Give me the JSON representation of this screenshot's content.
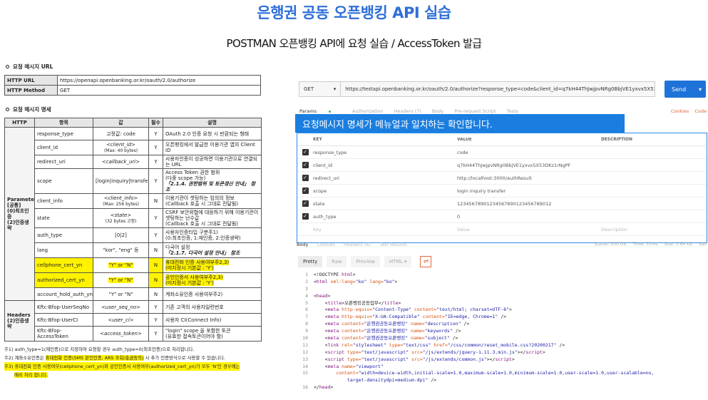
{
  "slide": {
    "title": "은행권 공동 오픈뱅킹 API 실습",
    "subtitle": "POSTMAN 오픈뱅킹 API에 요청 실습 / AccessToken 발급"
  },
  "doc": {
    "url_section": {
      "heading": "요청 메시지 URL",
      "http_url_key": "HTTP URL",
      "http_url_value": "https://openapi.openbanking.or.kr/oauth/2.0/authorize",
      "http_method_key": "HTTP Method",
      "http_method_value": "GET"
    },
    "spec_section": {
      "heading": "요청 메시지 명세",
      "columns": [
        "HTTP",
        "항목",
        "값",
        "필수",
        "설명"
      ],
      "group_params": "Parameter\n[공통]\n(0)최초인증\n(2)인증생략",
      "group_headers": "Headers\n(2)인증생략",
      "rows": [
        {
          "name": "response_type",
          "value": "고정값: code",
          "req": "Y",
          "desc": "OAuth 2.0 인증 요청 시 반환되는 형태"
        },
        {
          "name": "client_id",
          "value": "<client_id>",
          "value2": "(Max: 40 bytes)",
          "req": "Y",
          "desc": "오픈뱅킹에서 발급한 이용기관 앱의 Client ID"
        },
        {
          "name": "redirect_uri",
          "value": "<callback_uri>",
          "req": "Y",
          "desc": "사용자인증이 성공하면 이용기관으로 연결되는 URL"
        },
        {
          "name": "scope",
          "value": "[login|inquiry|transfer]",
          "req": "Y",
          "desc": "Access Token 권한 범위",
          "desc2": "(다중 scope 가능)",
          "desc3": "「2.1.4. 권한범위 및 토큰갱신 안내」 참조"
        },
        {
          "name": "client_info",
          "value": "<client_info>",
          "value2": "(Max: 256 bytes)",
          "req": "N",
          "desc": "이용기관이 셋팅하는 임의의 정보",
          "desc2": "(Callback 호출 시 그대로 전달됨)"
        },
        {
          "name": "state",
          "value": "<state>",
          "value2": "(32 bytes 고정)",
          "req": "Y",
          "desc": "CSRF 보안위협에 대응하기 위해 이용기관이 셋팅하는 난수값",
          "desc2": "(Callback 호출 시 그대로 전달됨)"
        },
        {
          "name": "auth_type",
          "value": "[0|2]",
          "req": "Y",
          "desc": "사용자인증타입 구분주1)",
          "desc2": "(0:최초인증, 1:재인증, 2:인증생략)"
        },
        {
          "name": "lang",
          "value": "\"kor\", \"eng\" 등",
          "req": "N",
          "desc": "다국어 설정",
          "desc2": "「2.1.7. 다국어 설정 안내」 참조"
        },
        {
          "name": "cellphone_cert_yn",
          "value": "\"Y\" or \"N\"",
          "req": "N",
          "desc": "휴대전화 인증 사용여부주2,3)",
          "desc2": "(미지정시 기본값 : 'Y')"
        },
        {
          "name": "authorized_cert_yn",
          "value": "\"Y\" or \"N\"",
          "req": "N",
          "desc": "공인인증서 사용여부주2,3)",
          "desc2": "(미지정시 기본값 : 'Y')"
        },
        {
          "name": "account_hold_auth_yn",
          "value": "\"Y\" or \"N\"",
          "req": "N",
          "desc": "계좌소유인증 사용여부주2)"
        },
        {
          "name": "Kftc-Bfop-UserSeqNo",
          "value": "<user_seq_no>",
          "req": "Y",
          "desc": "기존 고객의 사용자일련번호"
        },
        {
          "name": "Kftc-Bfop-UserCI",
          "value": "<user_ci>",
          "req": "Y",
          "desc": "사용자 CI(Connect Info)"
        },
        {
          "name": "Kftc-Bfop-AccessToken",
          "value": "<access_token>",
          "req": "Y",
          "desc": "\"login\" scope 을 포함한 토큰",
          "desc2": "(유효한 접속토큰이어야 함)"
        }
      ],
      "notes": [
        "주1) auth_type=1(재인증)으로 지정하여 요청할 경우 auth_type=0(최초인증)으로 처리합니다.",
        "주2) 계좌소유인증은 휴대전화 인증(SMS 본인인증, ARS 조회/출금동의) 시 추가 인증방식으로 사용할 수 있습니다.",
        "주3) 휴대전화 인증 사용여부(cellphone_cert_yn)와 공인인증서 사용여부(authorized_cert_yn)가 모두 'N'인 경우에는",
        "에러 처리 합니다."
      ]
    }
  },
  "postman": {
    "method": "GET",
    "url": "https://testapi.openbanking.or.kr/oauth/2.0/authorize?response_type=code&client_id=q7kH44ThJwjpvNRg0BbjVE1yxvx5X53DKz1rN",
    "send_label": "Send",
    "tabs": [
      "Params",
      "Authorization",
      "Headers (7)",
      "Body",
      "Pre-request Script",
      "Tests"
    ],
    "tabs_right": [
      "Cookies",
      "Code"
    ],
    "callout": "요청메시지 명세가 메뉴얼과 일치하는 확인합니다.",
    "params_header": [
      "KEY",
      "VALUE",
      "DESCRIPTION"
    ],
    "params": [
      {
        "key": "response_type",
        "value": "code"
      },
      {
        "key": "client_id",
        "value": "q7kH44ThJwjpvNRg0BbjVE1yxvx5X53DKz1rNgPF"
      },
      {
        "key": "redirect_uri",
        "value": "http://localhost:3000/authResult"
      },
      {
        "key": "scope",
        "value": "login inquiry transfer"
      },
      {
        "key": "state",
        "value": "12345678901234567890123456789012"
      },
      {
        "key": "auth_type",
        "value": "0"
      }
    ],
    "params_placeholder": {
      "key": "Key",
      "value": "Value",
      "desc": "Description"
    },
    "response_tabs": [
      "Body",
      "Cookies",
      "Headers (6)",
      "Test Results"
    ],
    "response_status": [
      "Status: 200 OK",
      "Time: 31ms",
      "Size: 3.64 KB",
      "Sav"
    ],
    "view_modes": [
      "Pretty",
      "Raw",
      "Preview"
    ],
    "format": "HTML",
    "code_lines": [
      {
        "n": "1",
        "parts": [
          [
            "t",
            "<!DOCTYPE "
          ],
          [
            "tag",
            "html"
          ],
          [
            "t",
            ">"
          ]
        ]
      },
      {
        "n": "2",
        "parts": [
          [
            "t",
            "<"
          ],
          [
            "tag",
            "html "
          ],
          [
            "attr",
            "xml:lang="
          ],
          [
            "str",
            "\"ko\" "
          ],
          [
            "attr",
            "lang="
          ],
          [
            "str",
            "\"ko\""
          ],
          [
            "t",
            ">"
          ]
        ]
      },
      {
        "n": "3",
        "parts": []
      },
      {
        "n": "4",
        "parts": [
          [
            "t",
            "<"
          ],
          [
            "tag",
            "head"
          ],
          [
            "t",
            ">"
          ]
        ]
      },
      {
        "n": "5",
        "parts": [
          [
            "t",
            "    <"
          ],
          [
            "tag",
            "title"
          ],
          [
            "t",
            ">오픈뱅킹공동업무</"
          ],
          [
            "tag",
            "title"
          ],
          [
            "t",
            ">"
          ]
        ]
      },
      {
        "n": "6",
        "parts": [
          [
            "t",
            "    <"
          ],
          [
            "tag",
            "meta "
          ],
          [
            "attr",
            "http-equiv="
          ],
          [
            "str",
            "\"Content-Type\" "
          ],
          [
            "attr",
            "content="
          ],
          [
            "str",
            "\"text/html; charset=UTF-8\""
          ],
          [
            "t",
            ">"
          ]
        ]
      },
      {
        "n": "7",
        "parts": [
          [
            "t",
            "    <"
          ],
          [
            "tag",
            "meta "
          ],
          [
            "attr",
            "http-equiv="
          ],
          [
            "str",
            "\"X-UA-Compatible\" "
          ],
          [
            "attr",
            "content="
          ],
          [
            "str",
            "\"IE=edge, Chrome=1\" "
          ],
          [
            "t",
            "/>"
          ]
        ]
      },
      {
        "n": "8",
        "parts": [
          [
            "t",
            "    <"
          ],
          [
            "tag",
            "meta "
          ],
          [
            "attr",
            "content="
          ],
          [
            "str",
            "\"은행권공동오픈뱅킹\" "
          ],
          [
            "attr",
            "name="
          ],
          [
            "str",
            "\"description\" "
          ],
          [
            "t",
            "/>"
          ]
        ]
      },
      {
        "n": "9",
        "parts": [
          [
            "t",
            "    <"
          ],
          [
            "tag",
            "meta "
          ],
          [
            "attr",
            "content="
          ],
          [
            "str",
            "\"은행권공동오픈뱅킹\" "
          ],
          [
            "attr",
            "name="
          ],
          [
            "str",
            "\"keywords\" "
          ],
          [
            "t",
            "/>"
          ]
        ]
      },
      {
        "n": "10",
        "parts": [
          [
            "t",
            "    <"
          ],
          [
            "tag",
            "meta "
          ],
          [
            "attr",
            "content="
          ],
          [
            "str",
            "\"은행권공동오픈뱅킹\" "
          ],
          [
            "attr",
            "name="
          ],
          [
            "str",
            "\"subject\" "
          ],
          [
            "t",
            "/>"
          ]
        ]
      },
      {
        "n": "11",
        "parts": [
          [
            "t",
            "    <"
          ],
          [
            "tag",
            "link "
          ],
          [
            "attr",
            "rel="
          ],
          [
            "str",
            "\"stylesheet\" "
          ],
          [
            "attr",
            "type="
          ],
          [
            "str",
            "\"text/css\" "
          ],
          [
            "attr",
            "href="
          ],
          [
            "str",
            "\"/css/common/reset_mobile.css?20200217\" "
          ],
          [
            "t",
            "/>"
          ]
        ]
      },
      {
        "n": "12",
        "parts": [
          [
            "t",
            "    <"
          ],
          [
            "tag",
            "script "
          ],
          [
            "attr",
            "type="
          ],
          [
            "str",
            "\"text/javascript\" "
          ],
          [
            "attr",
            "src="
          ],
          [
            "str",
            "\"/js/extends/jquery-1.11.3.min.js\""
          ],
          [
            "t",
            "></"
          ],
          [
            "tag",
            "script"
          ],
          [
            "t",
            ">"
          ]
        ]
      },
      {
        "n": "13",
        "parts": [
          [
            "t",
            "    <"
          ],
          [
            "tag",
            "script "
          ],
          [
            "attr",
            "type="
          ],
          [
            "str",
            "\"text/javascript\" "
          ],
          [
            "attr",
            "src="
          ],
          [
            "str",
            "\"/js/extends/common.js\""
          ],
          [
            "t",
            "></"
          ],
          [
            "tag",
            "script"
          ],
          [
            "t",
            ">"
          ]
        ]
      },
      {
        "n": "14",
        "parts": [
          [
            "t",
            "    <"
          ],
          [
            "tag",
            "meta "
          ],
          [
            "attr",
            "name="
          ],
          [
            "str",
            "\"viewport\""
          ]
        ]
      },
      {
        "n": "15",
        "parts": [
          [
            "t",
            "        "
          ],
          [
            "attr",
            "content="
          ],
          [
            "str",
            "\"width=device-width,initial-scale=1.0,maximum-scale=1.0,minimum-scale=1.0,user-scale=1.0,user-scalable=no,"
          ]
        ]
      },
      {
        "n": "",
        "parts": [
          [
            "str",
            "            target-densitydpi=medium-dpi\" "
          ],
          [
            "t",
            "/>"
          ]
        ]
      },
      {
        "n": "16",
        "parts": [
          [
            "t",
            "</"
          ],
          [
            "tag",
            "head"
          ],
          [
            "t",
            ">"
          ]
        ]
      }
    ],
    "colors": {
      "accent": "#1e73d8",
      "callout": "#1a7ee0",
      "title": "#2f6fd8",
      "highlight": "#fff200"
    }
  }
}
